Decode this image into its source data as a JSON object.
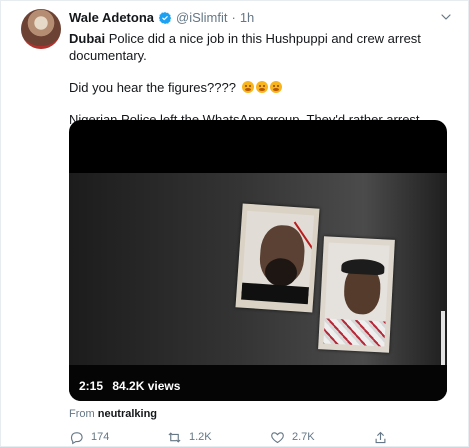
{
  "tweet": {
    "author_name": "Wale Adetona",
    "handle": "@iSlimfit",
    "separator": "·",
    "time": "1h",
    "text_part1_bold": "Dubai",
    "text_part1_rest": " Police did a nice job in this Hushpuppi and crew arrest documentary.",
    "text_part2": "Did you hear the figures????",
    "text_part3": "Nigerian Police left the WhatsApp group. They'd rather arrest without evidence and extort you for carrying Laptop.",
    "emoji_names": [
      "open-mouth-face-emoji",
      "open-mouth-face-emoji",
      "open-mouth-face-emoji"
    ],
    "verified_icon": "verified-badge-icon"
  },
  "video": {
    "duration": "2:15",
    "views": "84.2K views"
  },
  "from": {
    "label": "From",
    "source": "neutralking"
  },
  "actions": {
    "reply_count": "174",
    "retweet_count": "1.2K",
    "like_count": "2.7K"
  },
  "colors": {
    "accent": "#1da1f2",
    "text": "#14171a",
    "muted": "#657786",
    "border": "#e6ecf0"
  }
}
